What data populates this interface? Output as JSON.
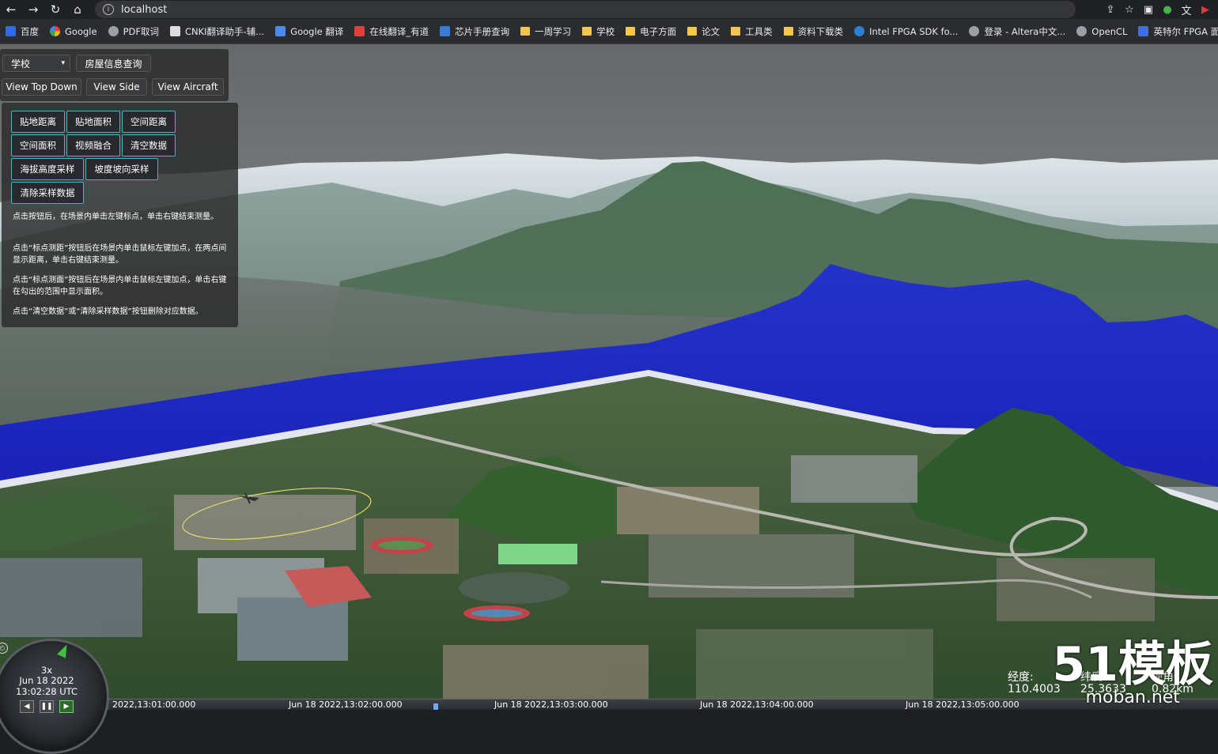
{
  "browser": {
    "url": "localhost",
    "bookmarks": [
      {
        "label": "百度",
        "icon": "baidu-icon"
      },
      {
        "label": "Google",
        "icon": "google-icon"
      },
      {
        "label": "PDF取词",
        "icon": "globe-icon"
      },
      {
        "label": "CNKI翻译助手-辅...",
        "icon": "cnki-icon"
      },
      {
        "label": "Google 翻译",
        "icon": "google-translate-icon"
      },
      {
        "label": "在线翻译_有道",
        "icon": "youdao-icon"
      },
      {
        "label": "芯片手册查询",
        "icon": "chip-icon"
      },
      {
        "label": "一周学习",
        "icon": "folder-icon"
      },
      {
        "label": "学校",
        "icon": "folder-icon"
      },
      {
        "label": "电子方面",
        "icon": "folder-icon"
      },
      {
        "label": "论文",
        "icon": "folder-icon"
      },
      {
        "label": "工具类",
        "icon": "folder-icon"
      },
      {
        "label": "资料下载类",
        "icon": "folder-icon"
      },
      {
        "label": "Intel FPGA SDK fo...",
        "icon": "intel-icon"
      },
      {
        "label": "登录 - Altera中文...",
        "icon": "globe-icon"
      },
      {
        "label": "OpenCL",
        "icon": "globe-icon"
      },
      {
        "label": "英特尔 FPGA 面向",
        "icon": "altera-icon"
      }
    ]
  },
  "toolbar": {
    "select_value": "学校",
    "house_query_label": "房屋信息查询",
    "view_top_down": "View Top Down",
    "view_side": "View Side",
    "view_aircraft": "View Aircraft"
  },
  "measure": {
    "buttons": [
      "贴地距离",
      "贴地面积",
      "空间距离",
      "空间面积",
      "视频融合",
      "清空数据",
      "海拔高度采样",
      "坡度坡向采样",
      "清除采样数据"
    ],
    "instructions": [
      "点击按钮后，在场景内单击左键标点，单击右键结束测量。",
      "点击“标点测距”按钮后在场景内单击鼠标左键加点，在两点间显示距离，单击右键结束测量。",
      "点击“标点测面”按钮后在场景内单击鼠标左键加点，单击右键在勾出的范围中显示面积。",
      "点击“清空数据”或“清除采样数据”按钮删除对应数据。"
    ]
  },
  "clock": {
    "speed": "3x",
    "date": "Jun 18 2022",
    "time": "13:02:28 UTC"
  },
  "timeline": {
    "labels": [
      "2022,13:01:00.000",
      "Jun 18 2022,13:02:00.000",
      "Jun 18 2022,13:03:00.000",
      "Jun 18 2022,13:04:00.000",
      "Jun 18 2022,13:05:00.000"
    ]
  },
  "coords": {
    "lon_label": "经度:",
    "lon_value": "110.4003",
    "lat_label": "纬度:",
    "lat_value": "25.3633",
    "view_label": "视角",
    "view_value": "0.82km"
  },
  "watermark": {
    "main": "51模板",
    "sub": "moban.net"
  },
  "colors": {
    "flood_blue": "#1f28c9",
    "button_border": "#48b5c4",
    "panel_bg": "#2a2a2a"
  }
}
